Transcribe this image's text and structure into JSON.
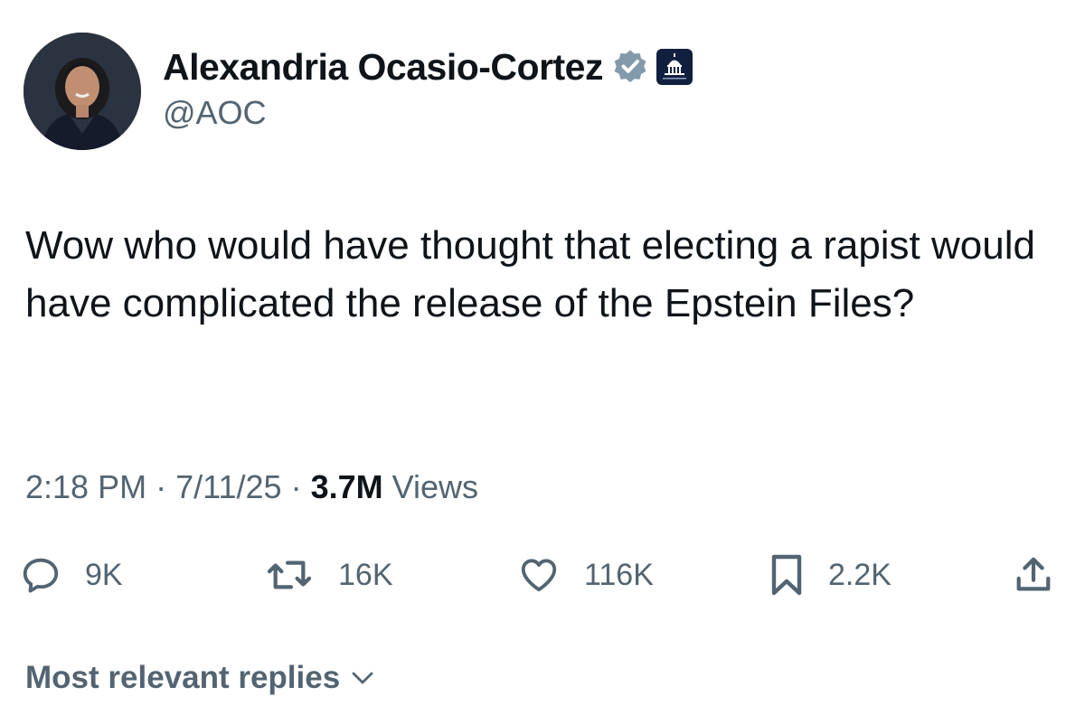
{
  "author": {
    "display_name": "Alexandria Ocasio-Cortez",
    "handle": "@AOC",
    "verified_badge_color": "#829aab",
    "avatar_icon": "profile-photo",
    "affiliation_icon": "capitol-dome-badge"
  },
  "tweet": {
    "text": "Wow who would have thought that electing a rapist would have complicated the release of the Epstein Files?",
    "time": "2:18 PM",
    "separator": "·",
    "date": "7/11/25",
    "views_count": "3.7M",
    "views_label": "Views"
  },
  "actions": {
    "reply": {
      "icon": "reply-bubble-icon",
      "count": "9K"
    },
    "retweet": {
      "icon": "retweet-icon",
      "count": "16K"
    },
    "like": {
      "icon": "heart-icon",
      "count": "116K"
    },
    "bookmark": {
      "icon": "bookmark-icon",
      "count": "2.2K"
    },
    "share": {
      "icon": "share-icon"
    }
  },
  "replies": {
    "sort_label": "Most relevant replies"
  },
  "colors": {
    "text_primary": "#0f1419",
    "text_secondary": "#536471",
    "background": "#ffffff"
  }
}
